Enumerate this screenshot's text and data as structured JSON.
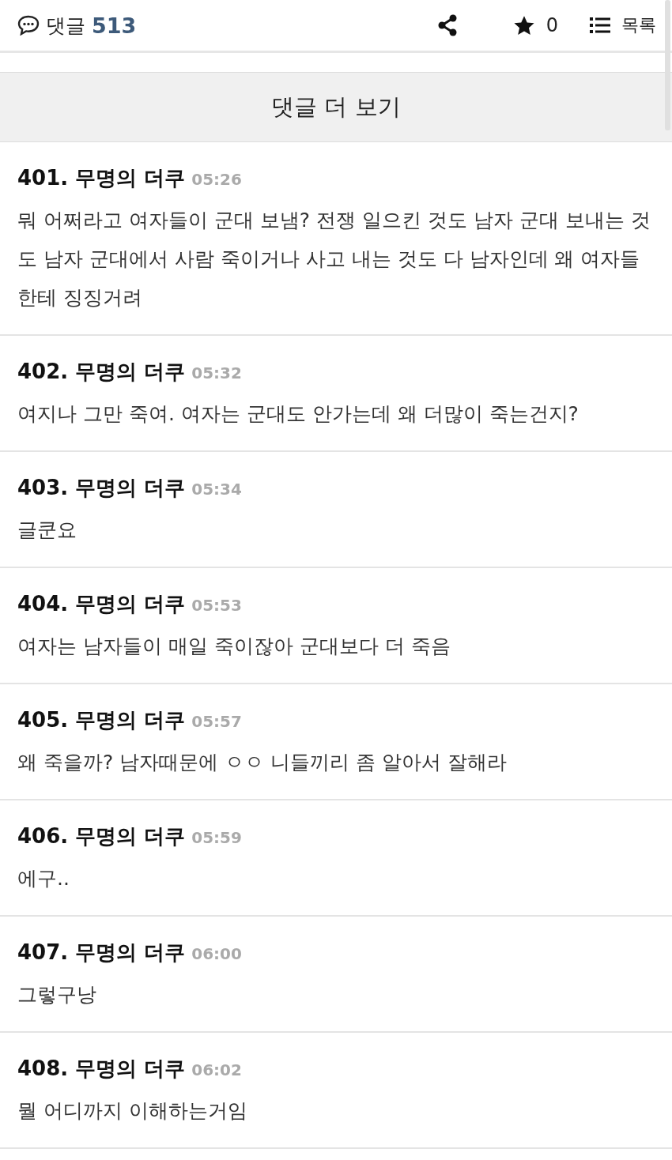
{
  "top_bar": {
    "comment_label": "댓글",
    "comment_count": "513",
    "star_count": "0",
    "list_label": "목록"
  },
  "more_button": "댓글 더 보기",
  "comments": [
    {
      "number": "401.",
      "author": "무명의 더쿠",
      "time": "05:26",
      "text": "뭐 어쩌라고 여자들이 군대 보냄? 전쟁 일으킨 것도 남자 군대 보내는 것도 남자 군대에서 사람 죽이거나 사고 내는 것도 다 남자인데 왜 여자들한테 징징거려"
    },
    {
      "number": "402.",
      "author": "무명의 더쿠",
      "time": "05:32",
      "text": "여지나 그만 죽여. 여자는 군대도 안가는데 왜 더많이 죽는건지?"
    },
    {
      "number": "403.",
      "author": "무명의 더쿠",
      "time": "05:34",
      "text": "글쿤요"
    },
    {
      "number": "404.",
      "author": "무명의 더쿠",
      "time": "05:53",
      "text": "여자는 남자들이 매일 죽이잖아 군대보다 더 죽음"
    },
    {
      "number": "405.",
      "author": "무명의 더쿠",
      "time": "05:57",
      "text": "왜 죽을까? 남자때문에 ㅇㅇ 니들끼리 좀 알아서 잘해라"
    },
    {
      "number": "406.",
      "author": "무명의 더쿠",
      "time": "05:59",
      "text": "에구.."
    },
    {
      "number": "407.",
      "author": "무명의 더쿠",
      "time": "06:00",
      "text": "그렇구낭"
    },
    {
      "number": "408.",
      "author": "무명의 더쿠",
      "time": "06:02",
      "text": "뭘 어디까지 이해하는거임"
    }
  ]
}
